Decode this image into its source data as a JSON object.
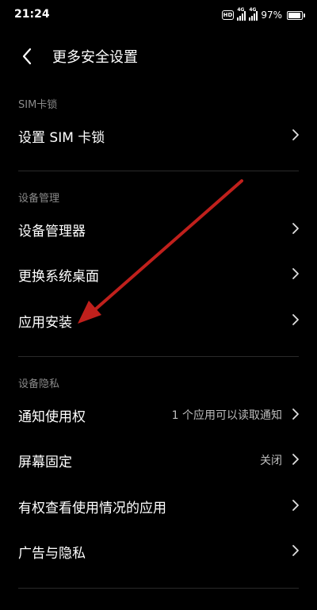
{
  "status_bar": {
    "time": "21:24",
    "hd_label": "HD",
    "network_1": "4G",
    "network_2": "4G",
    "battery_percent": "97%",
    "battery_level": 0.97
  },
  "header": {
    "back_icon": "chevron-left-icon",
    "title": "更多安全设置"
  },
  "sections": [
    {
      "title": "SIM卡锁",
      "items": [
        {
          "label": "设置 SIM 卡锁",
          "value": ""
        }
      ]
    },
    {
      "title": "设备管理",
      "items": [
        {
          "label": "设备管理器",
          "value": ""
        },
        {
          "label": "更换系统桌面",
          "value": ""
        },
        {
          "label": "应用安装",
          "value": ""
        }
      ]
    },
    {
      "title": "设备隐私",
      "items": [
        {
          "label": "通知使用权",
          "value": "1 个应用可以读取通知"
        },
        {
          "label": "屏幕固定",
          "value": "关闭"
        },
        {
          "label": "有权查看使用情况的应用",
          "value": ""
        },
        {
          "label": "广告与隐私",
          "value": ""
        }
      ]
    }
  ],
  "colors": {
    "background": "#000000",
    "text": "#ffffff",
    "section_header": "#8a8a8a",
    "secondary_value": "#bdbdbd",
    "annotation_arrow": "#c0201c"
  }
}
